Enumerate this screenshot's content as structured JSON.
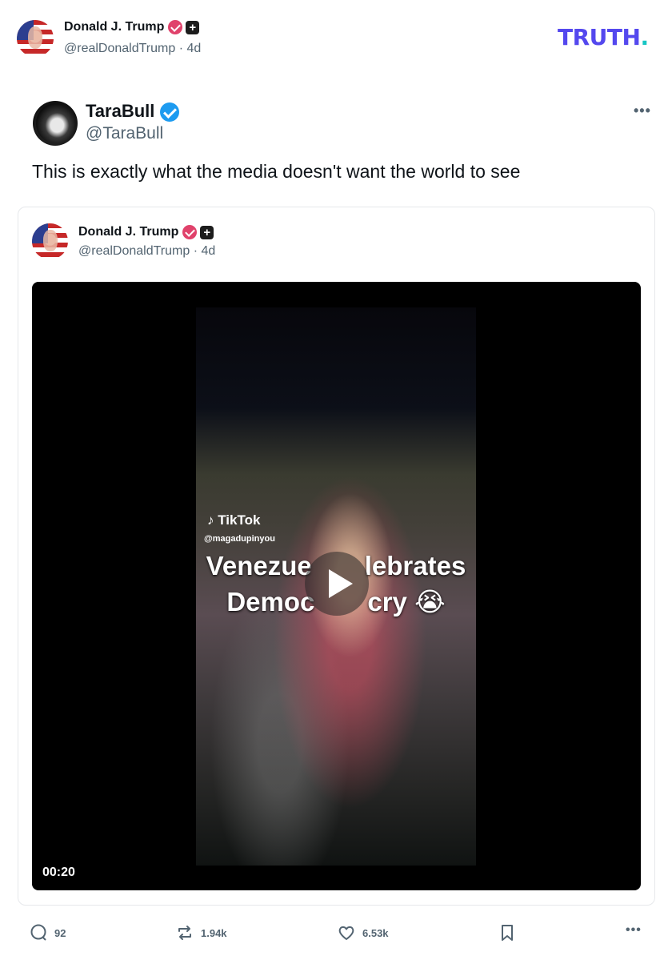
{
  "header": {
    "name": "Donald J. Trump",
    "handle": "@realDonaldTrump · 4d",
    "brand": "TRUTH",
    "brand_dot": "."
  },
  "embedded_tweet": {
    "name": "TaraBull",
    "handle": "@TaraBull",
    "text": "This is exactly what the media doesn't want the world to see",
    "more": "•••"
  },
  "quoted_post": {
    "name": "Donald J. Trump",
    "handle": "@realDonaldTrump · 4d"
  },
  "video": {
    "tiktok_label": "TikTok",
    "tiktok_user": "@magadupinyou",
    "caption_line1": "Venezue  lebrates",
    "caption_line2": "Democ  cry 😭",
    "duration": "00:20"
  },
  "actions": {
    "replies": "92",
    "retruths": "1.94k",
    "likes": "6.53k",
    "more": "•••"
  },
  "colors": {
    "brand": "#5448ee",
    "brand_accent": "#17c6c4",
    "verified_red": "#e0426b",
    "verified_blue": "#1d9bf0"
  }
}
